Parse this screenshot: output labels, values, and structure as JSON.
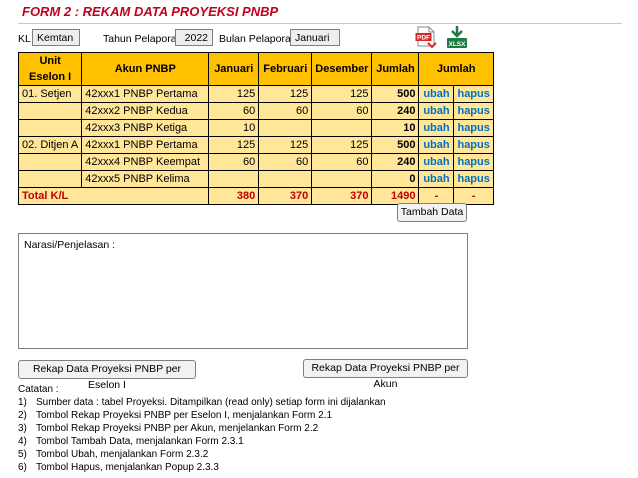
{
  "form_title": "FORM 2 : REKAM DATA PROYEKSI PNBP",
  "filters": {
    "kl_label": "KL",
    "kl_value": "Kemtan",
    "tahun_label": "Tahun Pelaporan",
    "tahun_value": "2022",
    "bulan_label": "Bulan Pelaporan",
    "bulan_value": "Januari"
  },
  "exports": {
    "pdf_label": "PDF",
    "xlsx_label": "XLSX"
  },
  "table": {
    "headers": [
      "Unit\nEselon I",
      "Akun PNBP",
      "Januari",
      "Februari",
      "Desember",
      "Jumlah",
      "Jumlah"
    ],
    "rows": [
      {
        "unit": "01. Setjen",
        "akun": "42xxx1 PNBP Pertama",
        "jan": "125",
        "feb": "125",
        "des": "125",
        "jumlah": "500",
        "ubah": "ubah",
        "hapus": "hapus"
      },
      {
        "unit": "",
        "akun": "42xxx2 PNBP Kedua",
        "jan": "60",
        "feb": "60",
        "des": "60",
        "jumlah": "240",
        "ubah": "ubah",
        "hapus": "hapus"
      },
      {
        "unit": "",
        "akun": "42xxx3 PNBP Ketiga",
        "jan": "10",
        "feb": "",
        "des": "",
        "jumlah": "10",
        "ubah": "ubah",
        "hapus": "hapus"
      },
      {
        "unit": "02. Ditjen A",
        "akun": "42xxx1 PNBP Pertama",
        "jan": "125",
        "feb": "125",
        "des": "125",
        "jumlah": "500",
        "ubah": "ubah",
        "hapus": "hapus"
      },
      {
        "unit": "",
        "akun": "42xxx4 PNBP Keempat",
        "jan": "60",
        "feb": "60",
        "des": "60",
        "jumlah": "240",
        "ubah": "ubah",
        "hapus": "hapus"
      },
      {
        "unit": "",
        "akun": "42xxx5 PNBP Kelima",
        "jan": "",
        "feb": "",
        "des": "",
        "jumlah": "0",
        "ubah": "ubah",
        "hapus": "hapus"
      }
    ],
    "total": {
      "label": "Total K/L",
      "jan": "380",
      "feb": "370",
      "des": "370",
      "jumlah": "1490",
      "ubah": "-",
      "hapus": "-"
    }
  },
  "buttons": {
    "tambah": "Tambah Data",
    "rekap_eselon": "Rekap Data Proyeksi PNBP per Eselon I",
    "rekap_akun": "Rekap Data Proyeksi PNBP per Akun"
  },
  "narasi_label": "Narasi/Penjelasan :",
  "catatan": {
    "title": "Catatan :",
    "items": [
      {
        "no": "1)",
        "text": "Sumber data : tabel Proyeksi. Ditampilkan (read only) setiap form ini dijalankan"
      },
      {
        "no": "2)",
        "text": "Tombol Rekap Proyeksi PNBP per Eselon I, menjalankan Form 2.1"
      },
      {
        "no": "3)",
        "text": "Tombol Rekap Proyeksi PNBP per Akun, menjelankan Form 2.2"
      },
      {
        "no": "4)",
        "text": "Tombol Tambah Data, menjalankan Form 2.3.1"
      },
      {
        "no": "5)",
        "text": "Tombol Ubah, menjalankan Form 2.3.2"
      },
      {
        "no": "6)",
        "text": "Tombol Hapus, menjalankan Popup 2.3.3"
      }
    ]
  },
  "colors": {
    "title": "#c0001e",
    "header_fill": "#ffc000",
    "body_fill": "#ffe699",
    "action_link": "#0070c0",
    "total_text": "#c00000",
    "pdf_icon": "#d9262c",
    "xlsx_icon": "#1f7a44"
  },
  "icons": [
    "pdf-file-icon",
    "xlsx-file-icon"
  ]
}
